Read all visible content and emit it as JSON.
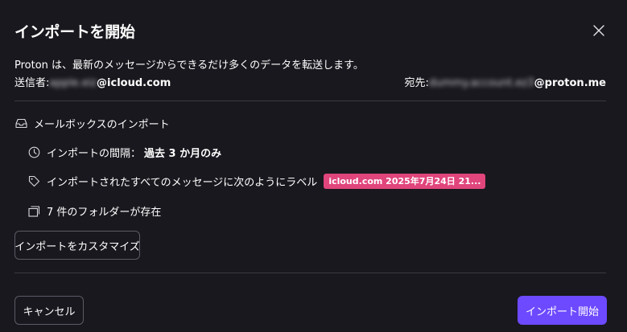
{
  "dialog": {
    "title": "インポートを開始",
    "intro": "Proton は、最新のメッセージからできるだけ多くのデータを転送します。",
    "from_label": "送信者:",
    "from_user_blurred": "apple.eiz",
    "from_domain": "@icloud.com",
    "to_label": "宛先:",
    "to_user_blurred": "dummy.account.ez3",
    "to_domain": "@proton.me"
  },
  "details": {
    "mailbox_label": "メールボックスのインポート",
    "interval_label": "インポートの間隔：",
    "interval_value": "過去 3 か月のみ",
    "label_text": "インポートされたすべてのメッセージに次のようにラベル",
    "label_tag": "icloud.com 2025年7月24日 21...",
    "folders_text": "7 件のフォルダーが存在"
  },
  "buttons": {
    "customize": "インポートをカスタマイズ",
    "cancel": "キャンセル",
    "start": "インポート開始"
  },
  "colors": {
    "background": "#19181e",
    "primary": "#6d4aff",
    "tag": "#e0457b",
    "divider": "#3b3a45"
  },
  "icons": {
    "close": "close-icon",
    "inbox": "inbox-icon",
    "clock": "clock-icon",
    "tag": "tag-icon",
    "folders": "folders-icon"
  }
}
